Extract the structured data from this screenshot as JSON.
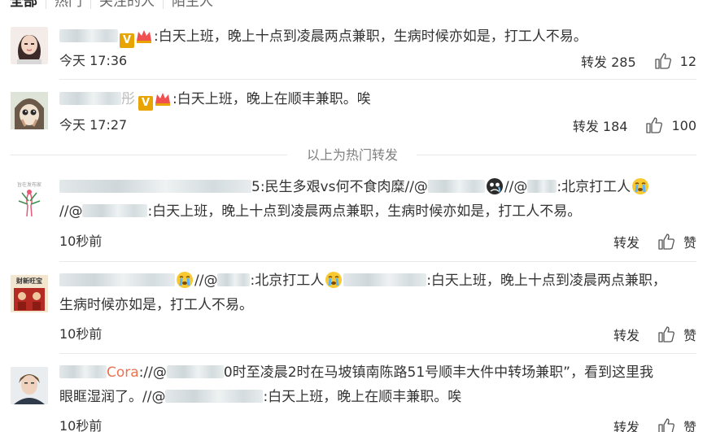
{
  "tabs": [
    "全部",
    "热门",
    "关注的人",
    "陌生人"
  ],
  "colors": {
    "nickname": "#eb7350",
    "text": "#333333",
    "muted": "#808080"
  },
  "hot_divider": "以上为热门转发",
  "comments": [
    {
      "text": ":白天上班，晚上十点到凌晨两点兼职，生病时候亦如是，打工人不易。",
      "time": "今天 17:36",
      "repost": "转发 285",
      "likes": "12"
    },
    {
      "nick_tail": "彤",
      "text": ":白天上班，晚上在顺丰兼职。唉",
      "time": "今天 17:27",
      "repost": "转发 184",
      "likes": "100"
    },
    {
      "line1_a": "5:民生多艰vs何不食肉糜//@",
      "line1_b": "波哥",
      "line1_c": "//@",
      "line1_d": ":北京打工人",
      "line2_a": "//@",
      "line2_b": ":白天上班，晚上十点到凌晨两点兼职，生病时候亦如是，打工人不易。",
      "time": "10秒前",
      "repost": "转发",
      "likes": "赞",
      "avatar_text": "旨在发布家"
    },
    {
      "line1_a": "//@",
      "line1_b": ":北京打工人",
      "line1_c": ":白天上班，晚上十点到凌晨两点兼职，",
      "line2": "生病时候亦如是，打工人不易。",
      "time": "10秒前",
      "repost": "转发",
      "likes": "赞",
      "avatar_text": "财新旺宝"
    },
    {
      "nick": "Cora",
      "line1_a": "://@",
      "line1_b": "0时至凌晨2时在马坡镇南陈路51号顺丰大件中转场兼职”，看到这里我",
      "line2_a": "眼眶湿润了。//@",
      "line2_b": ":白天上班，晚上在顺丰兼职。唉",
      "time": "10秒前",
      "repost": "转发",
      "likes": "赞"
    }
  ]
}
